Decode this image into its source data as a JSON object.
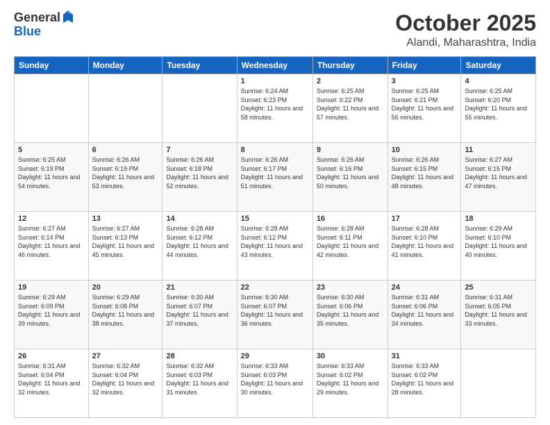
{
  "header": {
    "logo_general": "General",
    "logo_blue": "Blue",
    "month": "October 2025",
    "location": "Alandi, Maharashtra, India"
  },
  "days_of_week": [
    "Sunday",
    "Monday",
    "Tuesday",
    "Wednesday",
    "Thursday",
    "Friday",
    "Saturday"
  ],
  "weeks": [
    [
      {
        "day": "",
        "info": ""
      },
      {
        "day": "",
        "info": ""
      },
      {
        "day": "",
        "info": ""
      },
      {
        "day": "1",
        "info": "Sunrise: 6:24 AM\nSunset: 6:23 PM\nDaylight: 11 hours and 58 minutes."
      },
      {
        "day": "2",
        "info": "Sunrise: 6:25 AM\nSunset: 6:22 PM\nDaylight: 11 hours and 57 minutes."
      },
      {
        "day": "3",
        "info": "Sunrise: 6:25 AM\nSunset: 6:21 PM\nDaylight: 11 hours and 56 minutes."
      },
      {
        "day": "4",
        "info": "Sunrise: 6:25 AM\nSunset: 6:20 PM\nDaylight: 11 hours and 55 minutes."
      }
    ],
    [
      {
        "day": "5",
        "info": "Sunrise: 6:25 AM\nSunset: 6:19 PM\nDaylight: 11 hours and 54 minutes."
      },
      {
        "day": "6",
        "info": "Sunrise: 6:26 AM\nSunset: 6:19 PM\nDaylight: 11 hours and 53 minutes."
      },
      {
        "day": "7",
        "info": "Sunrise: 6:26 AM\nSunset: 6:18 PM\nDaylight: 11 hours and 52 minutes."
      },
      {
        "day": "8",
        "info": "Sunrise: 6:26 AM\nSunset: 6:17 PM\nDaylight: 11 hours and 51 minutes."
      },
      {
        "day": "9",
        "info": "Sunrise: 6:26 AM\nSunset: 6:16 PM\nDaylight: 11 hours and 50 minutes."
      },
      {
        "day": "10",
        "info": "Sunrise: 6:26 AM\nSunset: 6:15 PM\nDaylight: 11 hours and 48 minutes."
      },
      {
        "day": "11",
        "info": "Sunrise: 6:27 AM\nSunset: 6:15 PM\nDaylight: 11 hours and 47 minutes."
      }
    ],
    [
      {
        "day": "12",
        "info": "Sunrise: 6:27 AM\nSunset: 6:14 PM\nDaylight: 11 hours and 46 minutes."
      },
      {
        "day": "13",
        "info": "Sunrise: 6:27 AM\nSunset: 6:13 PM\nDaylight: 11 hours and 45 minutes."
      },
      {
        "day": "14",
        "info": "Sunrise: 6:28 AM\nSunset: 6:12 PM\nDaylight: 11 hours and 44 minutes."
      },
      {
        "day": "15",
        "info": "Sunrise: 6:28 AM\nSunset: 6:12 PM\nDaylight: 11 hours and 43 minutes."
      },
      {
        "day": "16",
        "info": "Sunrise: 6:28 AM\nSunset: 6:11 PM\nDaylight: 11 hours and 42 minutes."
      },
      {
        "day": "17",
        "info": "Sunrise: 6:28 AM\nSunset: 6:10 PM\nDaylight: 11 hours and 41 minutes."
      },
      {
        "day": "18",
        "info": "Sunrise: 6:29 AM\nSunset: 6:10 PM\nDaylight: 11 hours and 40 minutes."
      }
    ],
    [
      {
        "day": "19",
        "info": "Sunrise: 6:29 AM\nSunset: 6:09 PM\nDaylight: 11 hours and 39 minutes."
      },
      {
        "day": "20",
        "info": "Sunrise: 6:29 AM\nSunset: 6:08 PM\nDaylight: 11 hours and 38 minutes."
      },
      {
        "day": "21",
        "info": "Sunrise: 6:30 AM\nSunset: 6:07 PM\nDaylight: 11 hours and 37 minutes."
      },
      {
        "day": "22",
        "info": "Sunrise: 6:30 AM\nSunset: 6:07 PM\nDaylight: 11 hours and 36 minutes."
      },
      {
        "day": "23",
        "info": "Sunrise: 6:30 AM\nSunset: 6:06 PM\nDaylight: 11 hours and 35 minutes."
      },
      {
        "day": "24",
        "info": "Sunrise: 6:31 AM\nSunset: 6:06 PM\nDaylight: 11 hours and 34 minutes."
      },
      {
        "day": "25",
        "info": "Sunrise: 6:31 AM\nSunset: 6:05 PM\nDaylight: 11 hours and 33 minutes."
      }
    ],
    [
      {
        "day": "26",
        "info": "Sunrise: 6:31 AM\nSunset: 6:04 PM\nDaylight: 11 hours and 32 minutes."
      },
      {
        "day": "27",
        "info": "Sunrise: 6:32 AM\nSunset: 6:04 PM\nDaylight: 11 hours and 32 minutes."
      },
      {
        "day": "28",
        "info": "Sunrise: 6:32 AM\nSunset: 6:03 PM\nDaylight: 11 hours and 31 minutes."
      },
      {
        "day": "29",
        "info": "Sunrise: 6:33 AM\nSunset: 6:03 PM\nDaylight: 11 hours and 30 minutes."
      },
      {
        "day": "30",
        "info": "Sunrise: 6:33 AM\nSunset: 6:02 PM\nDaylight: 11 hours and 29 minutes."
      },
      {
        "day": "31",
        "info": "Sunrise: 6:33 AM\nSunset: 6:02 PM\nDaylight: 11 hours and 28 minutes."
      },
      {
        "day": "",
        "info": ""
      }
    ]
  ]
}
